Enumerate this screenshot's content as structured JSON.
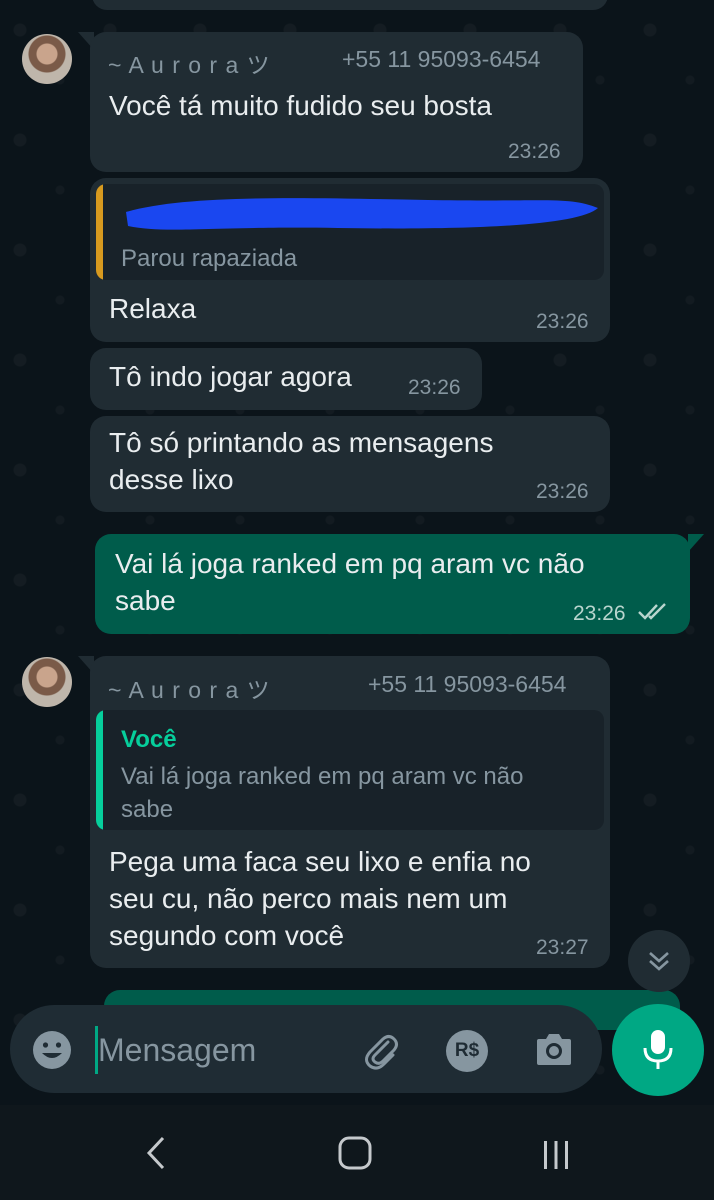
{
  "messages": [
    {
      "sender": "~ A u r o r a ツ",
      "phone": "+55 11 95093-6454",
      "text": "Você tá muito fudido seu bosta",
      "time": "23:26"
    },
    {
      "quote_text": "Parou rapaziada",
      "text": "Relaxa",
      "time": "23:26"
    },
    {
      "text": "Tô indo jogar agora",
      "time": "23:26"
    },
    {
      "line1": "Tô só printando as mensagens",
      "line2": "desse lixo",
      "time": "23:26"
    },
    {
      "line1": "Vai lá joga ranked em pq aram vc não",
      "line2": "sabe",
      "time": "23:26"
    },
    {
      "sender": "~ A u r o r a ツ",
      "phone": "+55 11 95093-6454",
      "quote_name": "Você",
      "quote_line1": "Vai lá joga ranked em pq aram vc não",
      "quote_line2": "sabe",
      "line1": "Pega uma faca seu lixo e enfia no",
      "line2": "seu cu, não perco mais nem um",
      "line3": "segundo com você",
      "time": "23:27"
    }
  ],
  "input": {
    "placeholder": "Mensagem"
  },
  "icons": {
    "emoji": "emoji-icon",
    "attach": "paperclip-icon",
    "payment": "payment-icon",
    "camera": "camera-icon",
    "mic": "mic-icon",
    "scroll": "chevron-double-down-icon",
    "back": "nav-back-icon",
    "home": "nav-home-icon",
    "recents": "nav-recents-icon"
  },
  "colors": {
    "incoming": "#202c33",
    "outgoing": "#005c4b",
    "accent": "#00a884",
    "quote_bar_orange": "#d79a1f",
    "redaction": "#1a47f0"
  }
}
